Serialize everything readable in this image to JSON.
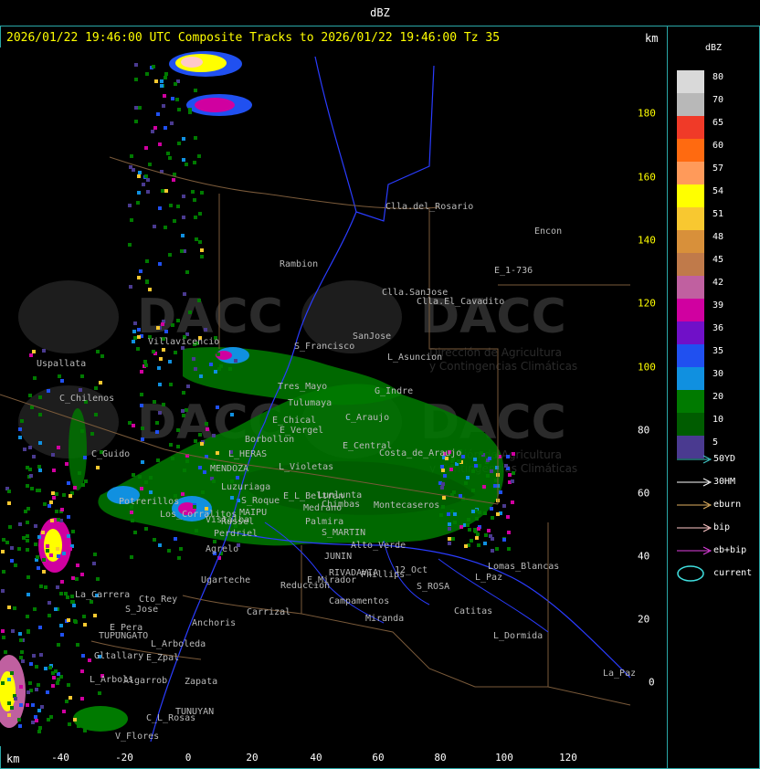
{
  "header": {
    "label": "dBZ"
  },
  "title": "2026/01/22 19:46:00 UTC Composite Tracks to 2026/01/22 19:46:00 Tz 35",
  "units": {
    "top_right": "km",
    "bottom_left": "km"
  },
  "x_axis": {
    "ticks": [
      "-40",
      "-20",
      "0",
      "20",
      "40",
      "60",
      "80",
      "100",
      "120"
    ]
  },
  "y_axis": {
    "ticks": [
      "180",
      "160",
      "140",
      "120",
      "100",
      "80",
      "60",
      "40",
      "20",
      "0"
    ]
  },
  "legend": {
    "title": "dBZ",
    "levels": [
      {
        "value": "80",
        "color": "#d9d9d9"
      },
      {
        "value": "70",
        "color": "#b8b8b8"
      },
      {
        "value": "65",
        "color": "#f03a28"
      },
      {
        "value": "60",
        "color": "#ff6a10"
      },
      {
        "value": "57",
        "color": "#ff9a5a"
      },
      {
        "value": "54",
        "color": "#ffff00"
      },
      {
        "value": "51",
        "color": "#f8c830"
      },
      {
        "value": "48",
        "color": "#d8903a"
      },
      {
        "value": "45",
        "color": "#c07a4a"
      },
      {
        "value": "42",
        "color": "#c060a0"
      },
      {
        "value": "39",
        "color": "#d000a0"
      },
      {
        "value": "36",
        "color": "#7010c8"
      },
      {
        "value": "35",
        "color": "#2050f0"
      },
      {
        "value": "30",
        "color": "#1090e0"
      },
      {
        "value": "20",
        "color": "#007a00"
      },
      {
        "value": "10",
        "color": "#005c00"
      },
      {
        "value": "5",
        "color": "#4a3a90"
      }
    ],
    "tracks": [
      {
        "label": "50YD",
        "color": "#40c8c8"
      },
      {
        "label": "30HM",
        "color": "#ffffff"
      },
      {
        "label": "eburn",
        "color": "#e0b060"
      },
      {
        "label": "bip",
        "color": "#ffc8c8"
      },
      {
        "label": "eb+bip",
        "color": "#e040e0"
      },
      {
        "label": "current",
        "color": "#40e0e0"
      }
    ]
  },
  "map": {
    "watermark": {
      "brand": "DACC",
      "line1": "Dirección de Agricultura",
      "line2": "y Contingencias Climáticas"
    },
    "places": [
      "Clla.del_Rosario",
      "Rambion",
      "Encon",
      "E_1-736",
      "Clla.SanJose",
      "Clla.El_Cavadito",
      "Uspallata",
      "Villavicencio",
      "S_Francisco",
      "SanJose",
      "L_Asuncion",
      "C_Chilenos",
      "Tres_Mayo",
      "G_Indre",
      "Tulumaya",
      "C_Araujo",
      "E_Chical",
      "E_Vergel",
      "Borbollon",
      "C_Guido",
      "L_HERAS",
      "MENDOZA",
      "E_Central",
      "Costa_de_Araujo",
      "L_Violetas",
      "Potrerillos",
      "Luzuriaga",
      "E_L_Beltran",
      "S_Roque",
      "MAIPU",
      "Russel",
      "Lunlunta",
      "Medrano",
      "L_Paz",
      "S_MARTIN",
      "JUNIN",
      "RIVADAVIA",
      "Phillips",
      "12_Oct",
      "S_ROSA",
      "Lomas_Blancas",
      "Agrelo",
      "Ugarteche",
      "La_Carrera",
      "Cto_Rey",
      "S_Jose",
      "Anchoris",
      "Carrizal",
      "E_Pera",
      "TUPUNGATO",
      "L_Arboleda",
      "Gltallary",
      "E_Zpal",
      "L_Arbols",
      "Zapata",
      "Algarrob",
      "TUNUYAN",
      "V_Flores",
      "C_L_Rosas",
      "Miranda",
      "L_Dormida",
      "Catitas",
      "Campamentos",
      "Montecaseros",
      "Chimbas",
      "Palmira",
      "Alto_Verde",
      "Reduccion",
      "E_Mirador",
      "Los_Corralitos",
      "Vistalba",
      "Perdriel",
      "La_Paz"
    ]
  }
}
